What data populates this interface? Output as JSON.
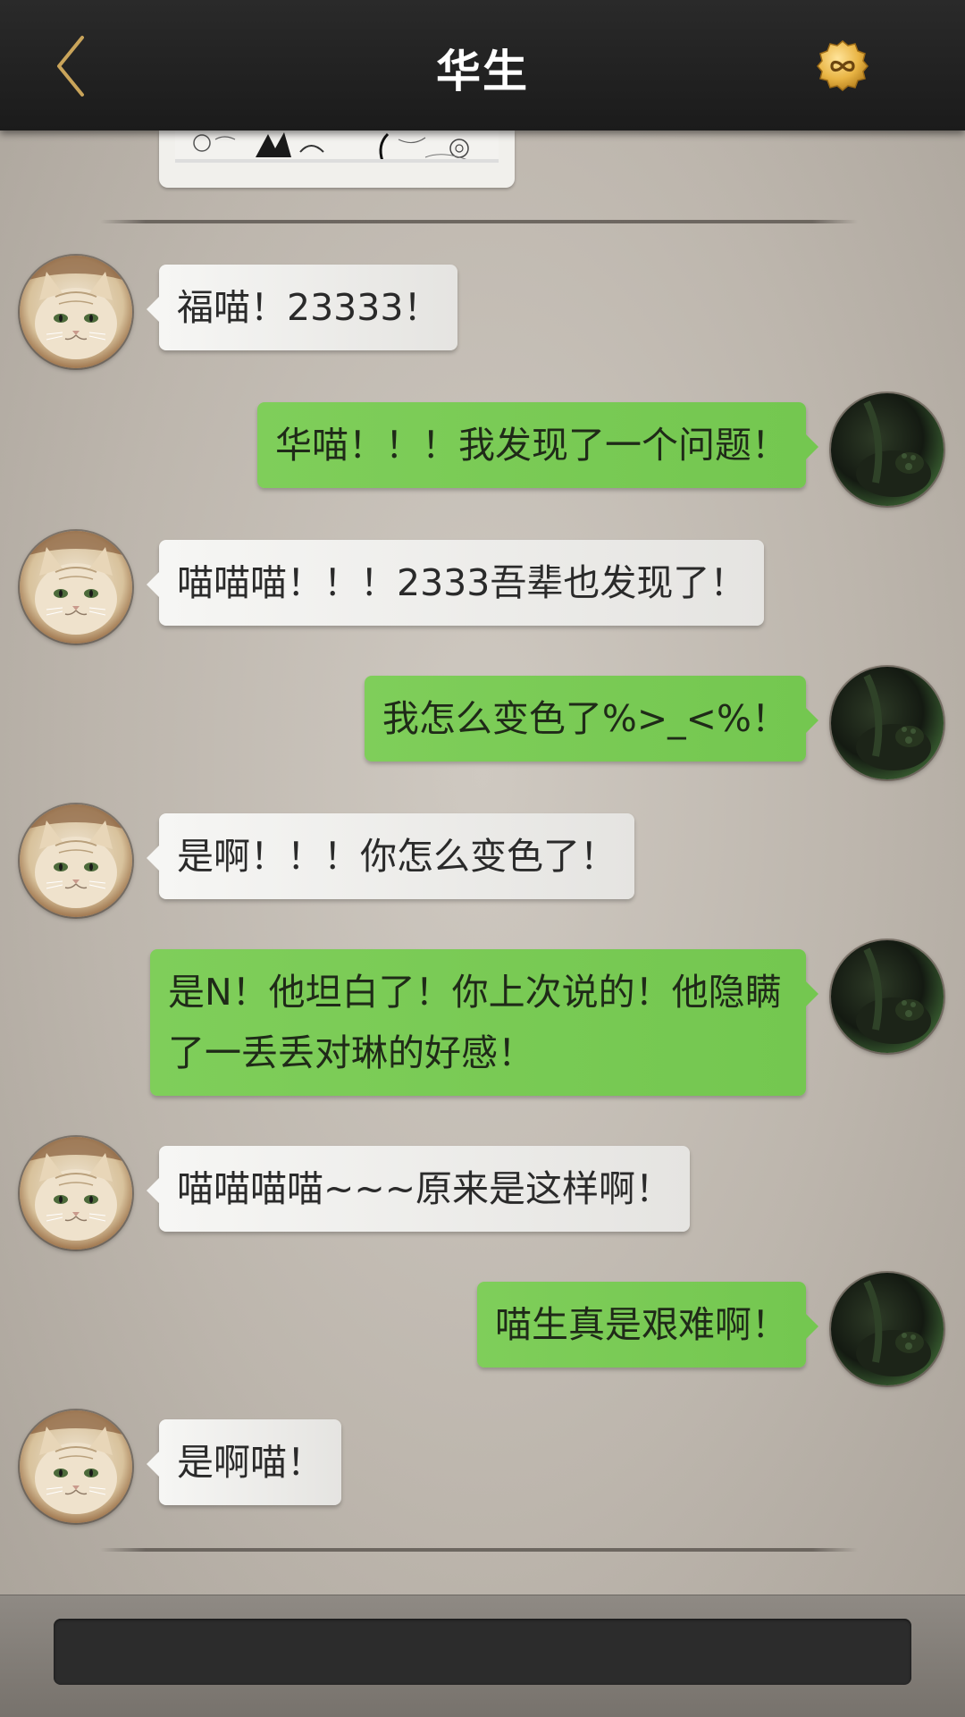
{
  "header": {
    "title": "华生",
    "back_icon": "chevron-left-icon",
    "right_icon": "infinity-coin-icon",
    "accent_color": "#c9a45a"
  },
  "messages": [
    {
      "sender": "other",
      "text": "福喵！23333！"
    },
    {
      "sender": "me",
      "text": "华喵！！！我发现了一个问题！"
    },
    {
      "sender": "other",
      "text": "喵喵喵！！！2333吾辈也发现了！"
    },
    {
      "sender": "me",
      "text": "我怎么变色了%>_<%！"
    },
    {
      "sender": "other",
      "text": "是啊！！！你怎么变色了！"
    },
    {
      "sender": "me",
      "text": "是N！他坦白了！你上次说的！他隐瞒了一丢丢对琳的好感！"
    },
    {
      "sender": "other",
      "text": "喵喵喵喵~~~原来是这样啊！"
    },
    {
      "sender": "me",
      "text": "喵生真是艰难啊！"
    },
    {
      "sender": "other",
      "text": "是啊喵！"
    }
  ],
  "colors": {
    "my_bubble": "#7fce5a",
    "other_bubble": "#f2f2f0",
    "topbar": "#222222",
    "input": "#2c2c2c"
  },
  "input": {
    "value": "",
    "placeholder": ""
  }
}
